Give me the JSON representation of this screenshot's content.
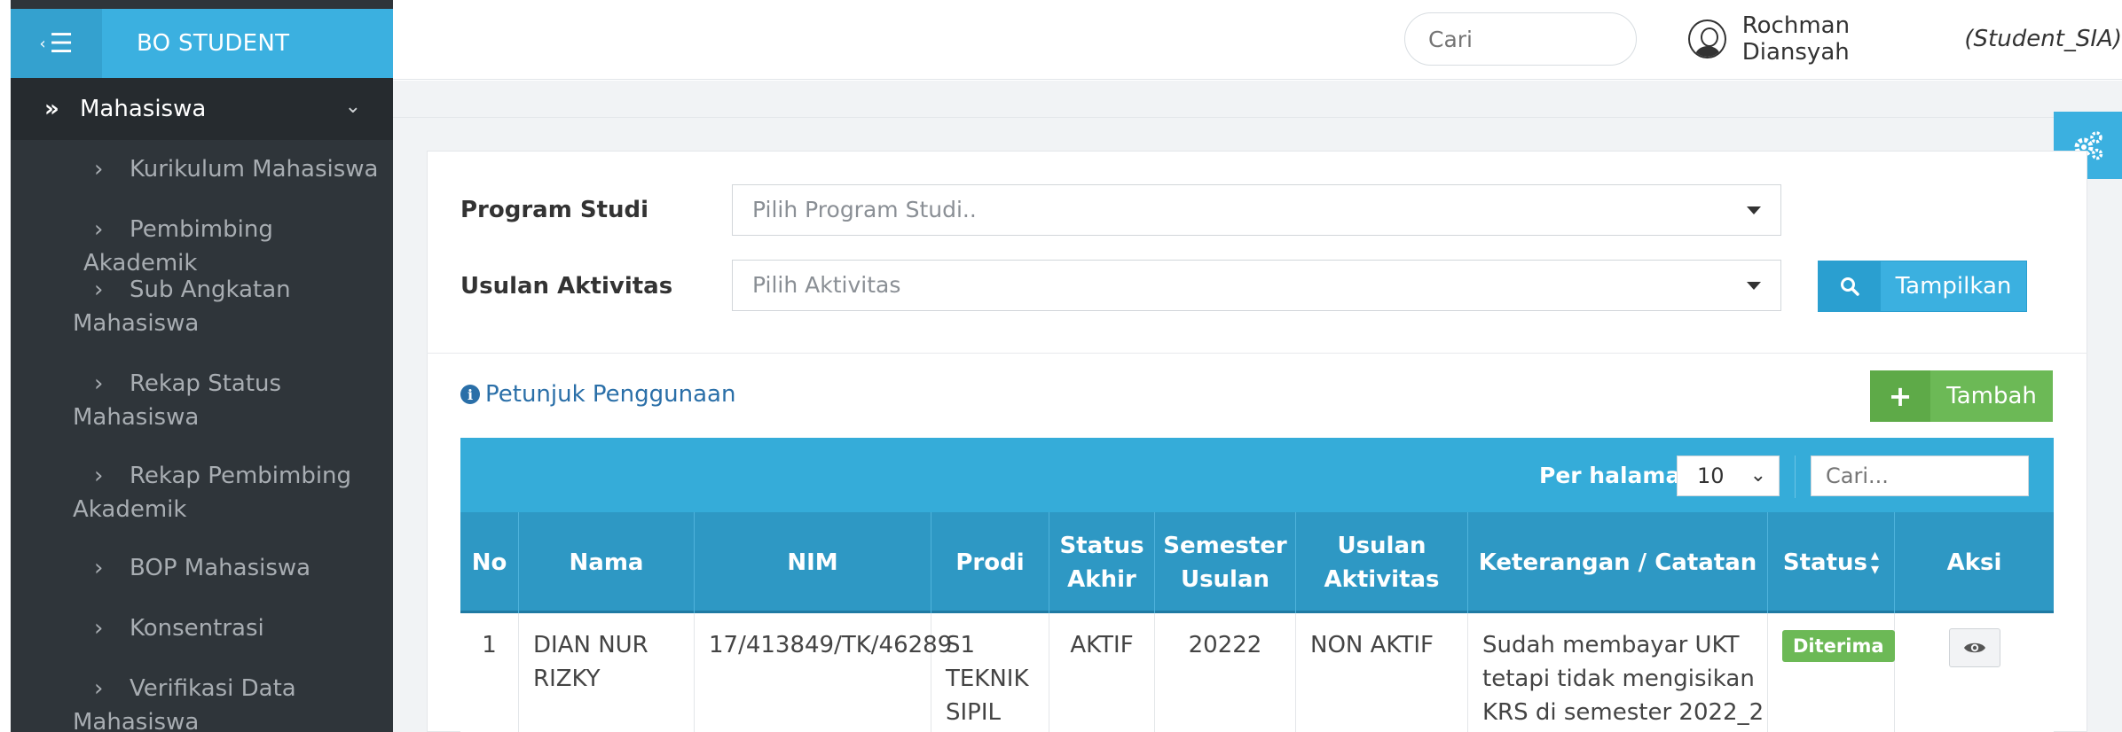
{
  "brand": "BO STUDENT",
  "sidebar": {
    "group_label": "Mahasiswa",
    "items": [
      {
        "label": "Kurikulum Mahasiswa"
      },
      {
        "label": "Pembimbing Akademik"
      },
      {
        "label_line1": "Sub Angkatan",
        "label_line2": "Mahasiswa"
      },
      {
        "label_line1": "Rekap Status",
        "label_line2": "Mahasiswa"
      },
      {
        "label_line1": "Rekap Pembimbing",
        "label_line2": "Akademik"
      },
      {
        "label": "BOP Mahasiswa"
      },
      {
        "label": "Konsentrasi"
      },
      {
        "label_line1": "Verifikasi Data",
        "label_line2": "Mahasiswa"
      }
    ]
  },
  "header": {
    "search_placeholder": "Cari",
    "user_name": "Rochman Diansyah",
    "user_role": "(Student_SIA)"
  },
  "filter": {
    "program_label": "Program Studi",
    "program_placeholder": "Pilih Program Studi..",
    "aktivitas_label": "Usulan Aktivitas",
    "aktivitas_placeholder": "Pilih Aktivitas",
    "show_button": "Tampilkan"
  },
  "help_link": "Petunjuk Penggunaan",
  "add_button": "Tambah",
  "table": {
    "per_page_label": "Per halaman",
    "per_page_value": "10",
    "search_placeholder": "Cari...",
    "headers": {
      "no": "No",
      "nama": "Nama",
      "nim": "NIM",
      "prodi": "Prodi",
      "status_akhir_1": "Status",
      "status_akhir_2": "Akhir",
      "semester_1": "Semester",
      "semester_2": "Usulan",
      "usulan_1": "Usulan",
      "usulan_2": "Aktivitas",
      "keterangan": "Keterangan / Catatan",
      "status": "Status",
      "aksi": "Aksi"
    },
    "rows": [
      {
        "no": "1",
        "nama_1": "DIAN NUR",
        "nama_2": "RIZKY",
        "nim": "17/413849/TK/46289",
        "prodi_1": "S1",
        "prodi_2": "TEKNIK",
        "prodi_3": "SIPIL",
        "status_akhir": "AKTIF",
        "semester": "20222",
        "usulan": "NON AKTIF",
        "ket_1": "Sudah membayar UKT",
        "ket_2": "tetapi tidak mengisikan",
        "ket_3": "KRS di semester 2022_2",
        "status": "Diterima"
      }
    ]
  },
  "colors": {
    "sidebar_bg": "#2f353a",
    "brand_blue": "#3bb0e0",
    "table_header": "#2e98c4",
    "success_green": "#6cb956"
  }
}
